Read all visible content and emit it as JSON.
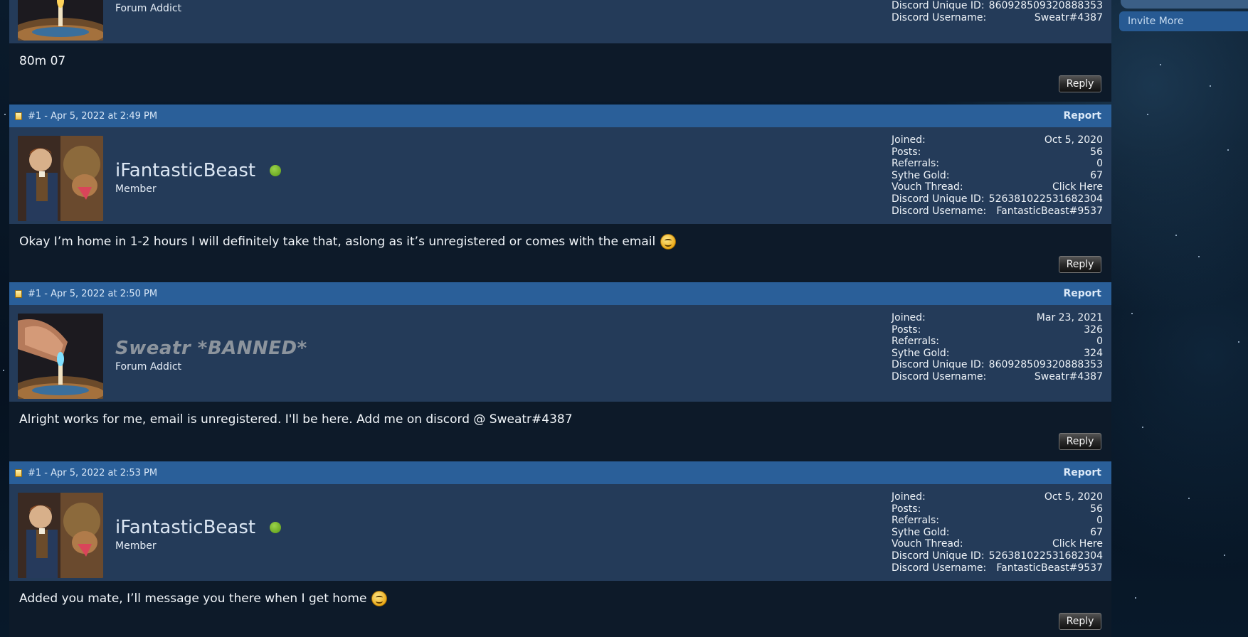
{
  "sidebar": {
    "invite_more": "Invite More"
  },
  "posts": [
    {
      "stats": [
        {
          "label": "Discord Unique ID:",
          "value": "860928509320888353"
        },
        {
          "label": "Discord Username:",
          "value": "Sweatr#4387"
        }
      ],
      "username": "",
      "rank": "Forum Addict",
      "message": "80m 07",
      "reply": "Reply"
    },
    {
      "meta": "#1 - Apr 5, 2022 at 2:49 PM",
      "report": "Report",
      "username": "iFantasticBeast",
      "rank": "Member",
      "stats": [
        {
          "label": "Joined:",
          "value": "Oct 5, 2020"
        },
        {
          "label": "Posts:",
          "value": "56"
        },
        {
          "label": "Referrals:",
          "value": "0"
        },
        {
          "label": "Sythe Gold:",
          "value": "67"
        },
        {
          "label": "Vouch Thread:",
          "value": "Click Here"
        },
        {
          "label": "Discord Unique ID:",
          "value": "526381022531682304"
        },
        {
          "label": "Discord Username:",
          "value": "FantasticBeast#9537"
        }
      ],
      "message": "Okay I’m home in 1-2 hours I will definitely take that, aslong as it’s unregistered or comes with the email",
      "reply": "Reply"
    },
    {
      "meta": "#1 - Apr 5, 2022 at 2:50 PM",
      "report": "Report",
      "username": "Sweatr *BANNED*",
      "rank": "Forum Addict",
      "stats": [
        {
          "label": "Joined:",
          "value": "Mar 23, 2021"
        },
        {
          "label": "Posts:",
          "value": "326"
        },
        {
          "label": "Referrals:",
          "value": "0"
        },
        {
          "label": "Sythe Gold:",
          "value": "324"
        },
        {
          "label": "Discord Unique ID:",
          "value": "860928509320888353"
        },
        {
          "label": "Discord Username:",
          "value": "Sweatr#4387"
        }
      ],
      "message": "Alright works for me, email is unregistered. I'll be here. Add me on discord @ Sweatr#4387",
      "reply": "Reply"
    },
    {
      "meta": "#1 - Apr 5, 2022 at 2:53 PM",
      "report": "Report",
      "username": "iFantasticBeast",
      "rank": "Member",
      "stats": [
        {
          "label": "Joined:",
          "value": "Oct 5, 2020"
        },
        {
          "label": "Posts:",
          "value": "56"
        },
        {
          "label": "Referrals:",
          "value": "0"
        },
        {
          "label": "Sythe Gold:",
          "value": "67"
        },
        {
          "label": "Vouch Thread:",
          "value": "Click Here"
        },
        {
          "label": "Discord Unique ID:",
          "value": "526381022531682304"
        },
        {
          "label": "Discord Username:",
          "value": "FantasticBeast#9537"
        }
      ],
      "message": "Added you mate, I’ll message you there when I get home",
      "reply": "Reply"
    }
  ],
  "colors": {
    "post_header": "#2a5f99",
    "user_row": "#243b59",
    "post_body": "#0d1a29",
    "online": "#7ab32e"
  }
}
